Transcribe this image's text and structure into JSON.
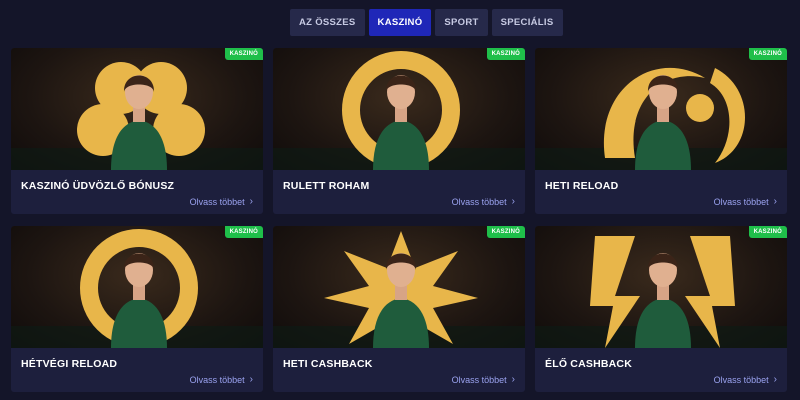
{
  "tabs": [
    {
      "label": "AZ ÖSSZES"
    },
    {
      "label": "KASZINÓ"
    },
    {
      "label": "SPORT"
    },
    {
      "label": "SPECIÁLIS"
    }
  ],
  "active_tab": "KASZINÓ",
  "cards": [
    {
      "badge": "KASZINÓ",
      "title": "KASZINÓ ÜDVÖZLŐ BÓNUSZ",
      "link": "Olvass többet",
      "shape": "clover"
    },
    {
      "badge": "KASZINÓ",
      "title": "RULETT ROHAM",
      "link": "Olvass többet",
      "shape": "ring"
    },
    {
      "badge": "KASZINÓ",
      "title": "HETI RELOAD",
      "link": "Olvass többet",
      "shape": "swirl"
    },
    {
      "badge": "KASZINÓ",
      "title": "HÉTVÉGI RELOAD",
      "link": "Olvass többet",
      "shape": "ring"
    },
    {
      "badge": "KASZINÓ",
      "title": "HETI CASHBACK",
      "link": "Olvass többet",
      "shape": "burst"
    },
    {
      "badge": "KASZINÓ",
      "title": "ÉLŐ CASHBACK",
      "link": "Olvass többet",
      "shape": "bolt"
    }
  ],
  "colors": {
    "gold": "#e8b64a",
    "badge": "#1fbf4a",
    "dress": "#1f5c3c",
    "active_tab": "#1f27b8"
  }
}
